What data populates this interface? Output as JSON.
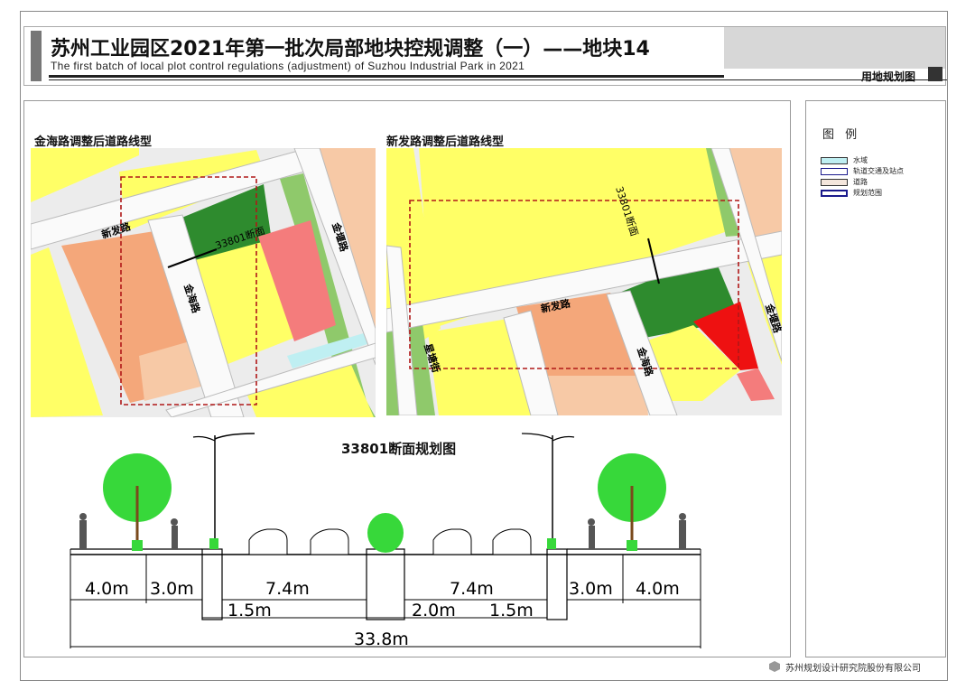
{
  "header": {
    "title_cn": "苏州工业园区2021年第一批次局部地块控规调整（一）——地块14",
    "title_en": "The first batch of local plot control regulations (adjustment) of Suzhou Industrial Park in 2021",
    "sheet_type": "用地规划图"
  },
  "maps": {
    "left": {
      "title": "金海路调整后道路线型",
      "labels": {
        "road_xinfa": "新发路",
        "road_jinhai": "金海路",
        "road_jinyan": "金堰路",
        "section": "33801断面"
      }
    },
    "right": {
      "title": "新发路调整后道路线型",
      "labels": {
        "road_xinfa": "新发路",
        "road_jinhai": "金海路",
        "road_jinyan": "金堰路",
        "road_xingtang": "星塘街",
        "section": "33801断面"
      }
    }
  },
  "section": {
    "title": "33801断面规划图",
    "dims": {
      "top_left_sidewalk": "4.0m",
      "top_left_bike": "3.0m",
      "top_left_lanes": "7.4m",
      "top_right_lanes": "7.4m",
      "top_right_bike": "3.0m",
      "top_right_sidewalk": "4.0m",
      "left_separator": "1.5m",
      "median": "2.0m",
      "right_separator": "1.5m",
      "total": "33.8m"
    }
  },
  "legend": {
    "title": "图 例",
    "items": [
      {
        "label": "水域",
        "color": "#bfeff2"
      },
      {
        "label": "轨道交通及站点",
        "color": "#ffffff"
      },
      {
        "label": "道路",
        "color": "#f4e6dc"
      },
      {
        "label": "规划范围",
        "color": "#1a1a8c"
      }
    ]
  },
  "footer": {
    "company": "苏州规划设计研究院股份有限公司"
  },
  "colors": {
    "residential": "#ffff66",
    "yellow_dark": "#f2f000",
    "green_dark": "#2e8b2e",
    "green_light": "#8fc96b",
    "salmon": "#f4a77a",
    "peach": "#f7c9a6",
    "pink": "#f47c7c",
    "red": "#ee1111",
    "road": "#eeeeee",
    "boundary": "#b01818"
  }
}
